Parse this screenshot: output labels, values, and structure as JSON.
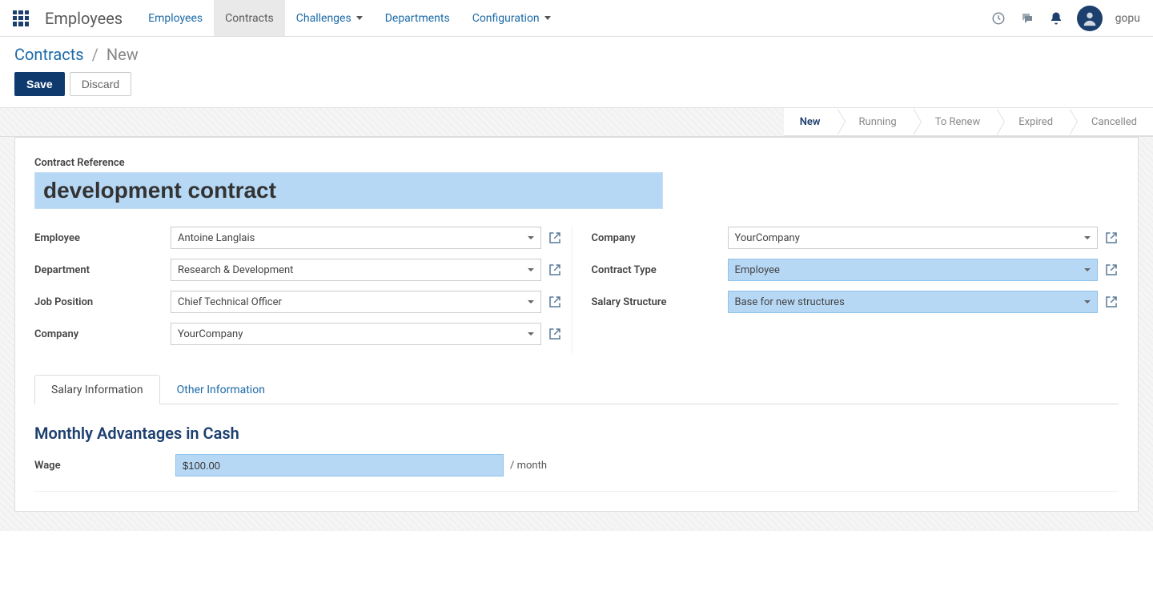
{
  "nav": {
    "app_title": "Employees",
    "items": [
      "Employees",
      "Contracts",
      "Challenges",
      "Departments",
      "Configuration"
    ],
    "user": "gopu"
  },
  "breadcrumb": {
    "link": "Contracts",
    "current": "New"
  },
  "buttons": {
    "save": "Save",
    "discard": "Discard"
  },
  "status": {
    "steps": [
      "New",
      "Running",
      "To Renew",
      "Expired",
      "Cancelled"
    ]
  },
  "form": {
    "ref_label": "Contract Reference",
    "ref_value": "development contract",
    "left": {
      "employee_label": "Employee",
      "employee_value": "Antoine Langlais",
      "department_label": "Department",
      "department_value": "Research & Development",
      "job_label": "Job Position",
      "job_value": "Chief Technical Officer",
      "company_label": "Company",
      "company_value": "YourCompany"
    },
    "right": {
      "company_label": "Company",
      "company_value": "YourCompany",
      "type_label": "Contract Type",
      "type_value": "Employee",
      "struct_label": "Salary Structure",
      "struct_value": "Base for new structures"
    }
  },
  "tabs": {
    "salary": "Salary Information",
    "other": "Other Information"
  },
  "salary": {
    "section_title": "Monthly Advantages in Cash",
    "wage_label": "Wage",
    "wage_value": "$100.00",
    "wage_suffix": "/ month"
  }
}
